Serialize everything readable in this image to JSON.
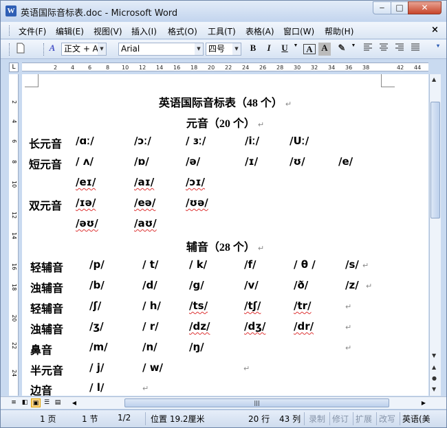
{
  "window": {
    "title": "英语国际音标表.doc - Microsoft Word",
    "minimize": "‒",
    "maximize": "□",
    "close": "✕"
  },
  "menu": [
    "文件(F)",
    "编辑(E)",
    "视图(V)",
    "插入(I)",
    "格式(O)",
    "工具(T)",
    "表格(A)",
    "窗口(W)",
    "帮助(H)"
  ],
  "menu_close": "×",
  "toolbar": {
    "style_box": "正文 + Aria",
    "font_box": "Arial",
    "size_box": "四号",
    "bold": "B",
    "italic": "I",
    "underline": "U",
    "char_border": "A",
    "char_shading": "A"
  },
  "ruler_numbers": [
    "2",
    "4",
    "6",
    "8",
    "10",
    "12",
    "14",
    "16",
    "18",
    "20",
    "22",
    "24",
    "26",
    "28",
    "30",
    "32",
    "34",
    "36",
    "38",
    "42",
    "44"
  ],
  "vruler_numbers": [
    "2",
    "4",
    "6",
    "8",
    "10",
    "12",
    "14",
    "16",
    "18",
    "20",
    "22",
    "24"
  ],
  "document": {
    "title": "英语国际音标表（48 个）",
    "vowel_heading": "元音（20 个）",
    "consonant_heading": "辅音（28 个）",
    "vowel_rows": [
      {
        "label": "长元音",
        "items": [
          "/ɑː/",
          "/ɔː/",
          "/ ɜː/",
          "/iː/",
          "/Uː/"
        ]
      },
      {
        "label": "短元音",
        "items": [
          "/ ʌ/",
          "/ɒ/",
          "/ə/",
          "/ɪ/",
          "/ʊ/",
          "/e/"
        ]
      },
      {
        "label": "",
        "items": [
          "/eɪ/",
          "/aɪ/",
          "/ɔɪ/"
        ]
      },
      {
        "label": "双元音",
        "items": [
          "/ɪə/",
          "/eə/",
          "/ʊə/"
        ]
      },
      {
        "label": "",
        "items": [
          "/əʊ/",
          "/aʊ/"
        ]
      }
    ],
    "consonant_rows": [
      {
        "label": "轻辅音",
        "items": [
          "/p/",
          "/ t/",
          "/ k/",
          "/f/",
          "/ θ /",
          "/s/"
        ]
      },
      {
        "label": "浊辅音",
        "items": [
          "/b/",
          "/d/",
          "/g/",
          "/v/",
          "/ð/",
          "/z/"
        ]
      },
      {
        "label": "轻辅音",
        "items": [
          "/ʃ/",
          "/ h/",
          "/ts/",
          "/tʃ/",
          "/tr/"
        ]
      },
      {
        "label": "浊辅音",
        "items": [
          "/ʒ/",
          "/ r/",
          "/dz/",
          "/dʒ/",
          "/dr/"
        ]
      },
      {
        "label": "鼻音",
        "items": [
          "/m/",
          "/n/",
          "/ŋ/"
        ]
      },
      {
        "label": "半元音",
        "items": [
          "/ j/",
          "/ w/"
        ]
      },
      {
        "label": "边音",
        "items": [
          "/ l/"
        ]
      }
    ],
    "paragraph_mark": "↵"
  },
  "status": {
    "page": "1 页",
    "section": "1 节",
    "page_of": "1/2",
    "position": "位置 19.2厘米",
    "line": "20 行",
    "column": "43 列",
    "rec": "录制",
    "trk": "修订",
    "ext": "扩展",
    "ovr": "改写",
    "lang": "英语(美"
  },
  "colors": {
    "accent": "#2f5fb5",
    "chrome": "#c9daf0",
    "spell_underline": "#d33"
  }
}
